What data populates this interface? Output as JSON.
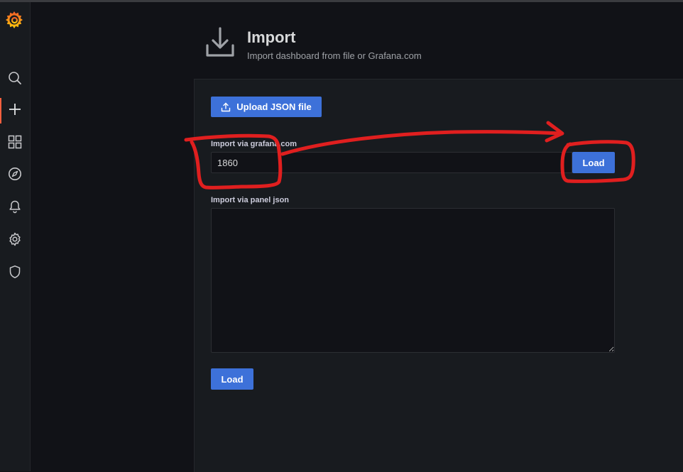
{
  "sidebar": {
    "items": [
      {
        "icon": "search-icon"
      },
      {
        "icon": "plus-icon",
        "active": true
      },
      {
        "icon": "dashboards-icon"
      },
      {
        "icon": "compass-icon"
      },
      {
        "icon": "bell-icon"
      },
      {
        "icon": "gear-icon"
      },
      {
        "icon": "shield-icon"
      }
    ]
  },
  "header": {
    "title": "Import",
    "subtitle": "Import dashboard from file or Grafana.com",
    "icon": "download-icon"
  },
  "upload": {
    "label": "Upload JSON file",
    "icon": "upload-icon"
  },
  "grafana_import": {
    "label": "Import via grafana.com",
    "value": "1860",
    "button_label": "Load"
  },
  "panel_json": {
    "label": "Import via panel json",
    "value": "",
    "button_label": "Load"
  },
  "colors": {
    "accent": "#3d71d9",
    "annotation": "#e01f1f",
    "active_nav": "#f55f3e"
  }
}
